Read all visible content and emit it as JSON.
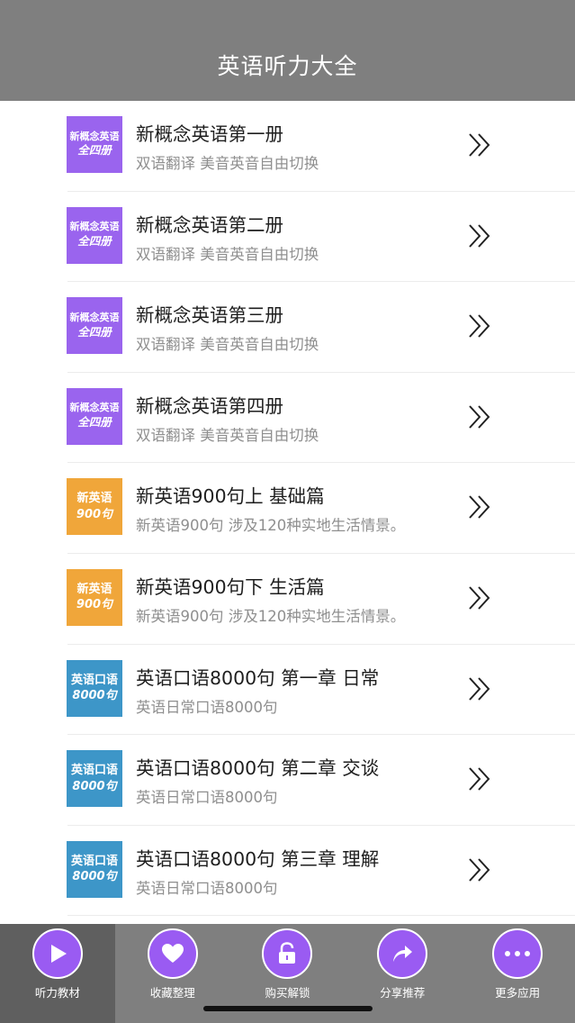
{
  "header": {
    "title": "英语听力大全"
  },
  "items": [
    {
      "thumb_line1": "新概念英语",
      "thumb_line2": "全四册",
      "thumb_color": "#9a64ee",
      "title": "新概念英语第一册",
      "subtitle": "双语翻译 美音英音自由切换"
    },
    {
      "thumb_line1": "新概念英语",
      "thumb_line2": "全四册",
      "thumb_color": "#9a64ee",
      "title": "新概念英语第二册",
      "subtitle": "双语翻译 美音英音自由切换"
    },
    {
      "thumb_line1": "新概念英语",
      "thumb_line2": "全四册",
      "thumb_color": "#9a64ee",
      "title": "新概念英语第三册",
      "subtitle": "双语翻译 美音英音自由切换"
    },
    {
      "thumb_line1": "新概念英语",
      "thumb_line2": "全四册",
      "thumb_color": "#9a64ee",
      "title": "新概念英语第四册",
      "subtitle": "双语翻译 美音英音自由切换"
    },
    {
      "thumb_line1": "新英语",
      "thumb_line2": "900句",
      "thumb_color": "#f0a63a",
      "title": "新英语900句上 基础篇",
      "subtitle": "新英语900句 涉及120种实地生活情景。"
    },
    {
      "thumb_line1": "新英语",
      "thumb_line2": "900句",
      "thumb_color": "#f0a63a",
      "title": "新英语900句下 生活篇",
      "subtitle": "新英语900句 涉及120种实地生活情景。"
    },
    {
      "thumb_line1": "英语口语",
      "thumb_line2": "8000句",
      "thumb_color": "#3d96c8",
      "title": "英语口语8000句 第一章 日常",
      "subtitle": "英语日常口语8000句"
    },
    {
      "thumb_line1": "英语口语",
      "thumb_line2": "8000句",
      "thumb_color": "#3d96c8",
      "title": "英语口语8000句 第二章 交谈",
      "subtitle": "英语日常口语8000句"
    },
    {
      "thumb_line1": "英语口语",
      "thumb_line2": "8000句",
      "thumb_color": "#3d96c8",
      "title": "英语口语8000句 第三章 理解",
      "subtitle": "英语日常口语8000句"
    }
  ],
  "tabs": [
    {
      "label": "听力教材",
      "icon": "play-icon",
      "active": true
    },
    {
      "label": "收藏整理",
      "icon": "heart-icon",
      "active": false
    },
    {
      "label": "购买解锁",
      "icon": "unlock-icon",
      "active": false
    },
    {
      "label": "分享推荐",
      "icon": "share-icon",
      "active": false
    },
    {
      "label": "更多应用",
      "icon": "more-icon",
      "active": false
    }
  ],
  "colors": {
    "header_bg": "#7f7f7f",
    "tab_circle": "#9a5bf2",
    "tab_active_bg": "#5f5f5f"
  }
}
